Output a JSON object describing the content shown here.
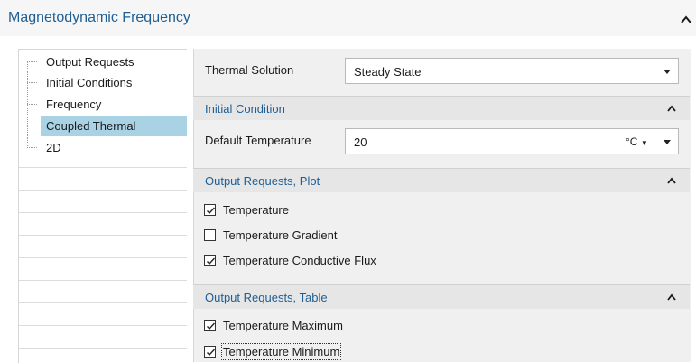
{
  "header": {
    "title": "Magnetodynamic Frequency",
    "collapse_icon": "chevron-up-icon"
  },
  "tree": {
    "items": [
      {
        "label": "Output Requests",
        "selected": false
      },
      {
        "label": "Initial Conditions",
        "selected": false
      },
      {
        "label": "Frequency",
        "selected": false
      },
      {
        "label": "Coupled Thermal",
        "selected": true
      },
      {
        "label": "2D",
        "selected": false
      }
    ]
  },
  "thermal": {
    "label": "Thermal Solution",
    "value": "Steady State"
  },
  "initial_condition": {
    "title": "Initial Condition",
    "default_temp_label": "Default Temperature",
    "default_temp_value": "20",
    "unit": "°C"
  },
  "plot": {
    "title": "Output Requests, Plot",
    "items": [
      {
        "label": "Temperature",
        "checked": true
      },
      {
        "label": "Temperature Gradient",
        "checked": false
      },
      {
        "label": "Temperature Conductive Flux",
        "checked": true
      }
    ]
  },
  "table": {
    "title": "Output Requests, Table",
    "items": [
      {
        "label": "Temperature Maximum",
        "checked": true
      },
      {
        "label": "Temperature Minimum",
        "checked": true
      }
    ]
  },
  "colors": {
    "accent": "#1f5f95",
    "selection": "#a9d2e4",
    "panel": "#f0f0f0",
    "section": "#e6e6e6"
  }
}
